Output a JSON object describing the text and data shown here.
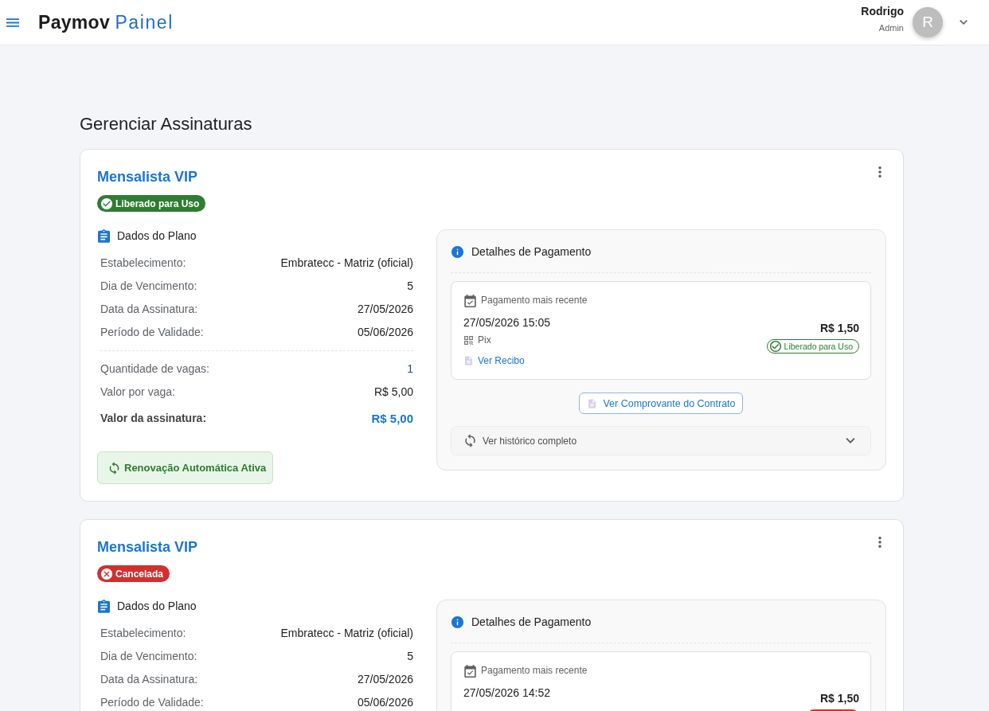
{
  "header": {
    "logo": {
      "primary": "Paymov",
      "secondary": "Painel"
    },
    "user": {
      "name": "Rodrigo",
      "role": "Admin",
      "initial": "R"
    }
  },
  "page_title": "Gerenciar Assinaturas",
  "subscriptions": [
    {
      "title": "Mensalista VIP",
      "status": {
        "kind": "released",
        "label": "Liberado para Uso"
      },
      "plan": {
        "heading": "Dados do Plano",
        "details": [
          {
            "label": "Estabelecimento:",
            "value": "Embratecc - Matriz (oficial)"
          },
          {
            "label": "Dia de Vencimento:",
            "value": "5"
          },
          {
            "label": "Data da Assinatura:",
            "value": "27/05/2026"
          },
          {
            "label": "Período de Validade:",
            "value": "05/06/2026"
          }
        ],
        "pricing": [
          {
            "label": "Quantidade de vagas:",
            "value": "1",
            "kind": "count"
          },
          {
            "label": "Valor por vaga:",
            "value": "R$ 5,00",
            "kind": "plain"
          }
        ],
        "total": {
          "label": "Valor da assinatura:",
          "value": "R$ 5,00"
        }
      },
      "auto_renewal": {
        "label": "Renovação Automática Ativa"
      },
      "payment": {
        "heading": "Detalhes de Pagamento",
        "latest": {
          "heading": "Pagamento mais recente",
          "datetime": "27/05/2026 15:05",
          "method": "Pix",
          "receipt_link": "Ver Recibo",
          "amount": "R$ 1,50",
          "status": {
            "kind": "released",
            "label": "Liberado para Uso"
          }
        },
        "contract_button": "Ver Comprovante do Contrato",
        "history": {
          "label": "Ver histórico completo",
          "expanded": false
        }
      }
    },
    {
      "title": "Mensalista VIP",
      "status": {
        "kind": "cancelled",
        "label": "Cancelada"
      },
      "plan": {
        "heading": "Dados do Plano",
        "details": [
          {
            "label": "Estabelecimento:",
            "value": "Embratecc - Matriz (oficial)"
          },
          {
            "label": "Dia de Vencimento:",
            "value": "5"
          },
          {
            "label": "Data da Assinatura:",
            "value": "27/05/2026"
          },
          {
            "label": "Período de Validade:",
            "value": "05/06/2026"
          }
        ]
      },
      "payment": {
        "heading": "Detalhes de Pagamento",
        "latest": {
          "heading": "Pagamento mais recente",
          "datetime": "27/05/2026 14:52",
          "amount": "R$ 1,50",
          "status": {
            "kind": "cancelled"
          }
        }
      }
    }
  ]
}
